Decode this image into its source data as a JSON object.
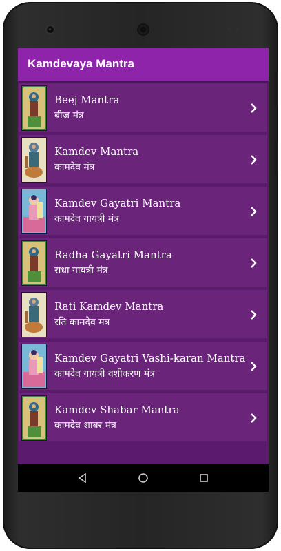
{
  "app": {
    "title": "Kamdevaya Mantra"
  },
  "colors": {
    "appbar": "#8e24aa",
    "background": "#5b1a6d",
    "row": "#6a2479",
    "navbar": "#000000"
  },
  "mantras": [
    {
      "title": "Beej Mantra",
      "subtitle": "बीज मंत्र",
      "thumb": "green-deity-image"
    },
    {
      "title": "Kamdev Mantra",
      "subtitle": "कामदेव मंत्र",
      "thumb": "blue-deity-image"
    },
    {
      "title": "Kamdev Gayatri Mantra",
      "subtitle": "कामदेव गायत्री मंत्र",
      "thumb": "pink-deity-image"
    },
    {
      "title": "Radha Gayatri Mantra",
      "subtitle": "राधा गायत्री मंत्र",
      "thumb": "green-deity-image"
    },
    {
      "title": "Rati Kamdev Mantra",
      "subtitle": "रति कामदेव मंत्र",
      "thumb": "blue-deity-image"
    },
    {
      "title": "Kamdev Gayatri Vashi-karan Mantra",
      "subtitle": "कामदेव गायत्री वशीकरण मंत्र",
      "thumb": "pink-deity-image"
    },
    {
      "title": "Kamdev Shabar Mantra",
      "subtitle": "कामदेव शाबर मंत्र",
      "thumb": "green-deity-image"
    }
  ],
  "navbar": {
    "back": "back-icon",
    "home": "home-icon",
    "recents": "recents-icon"
  }
}
